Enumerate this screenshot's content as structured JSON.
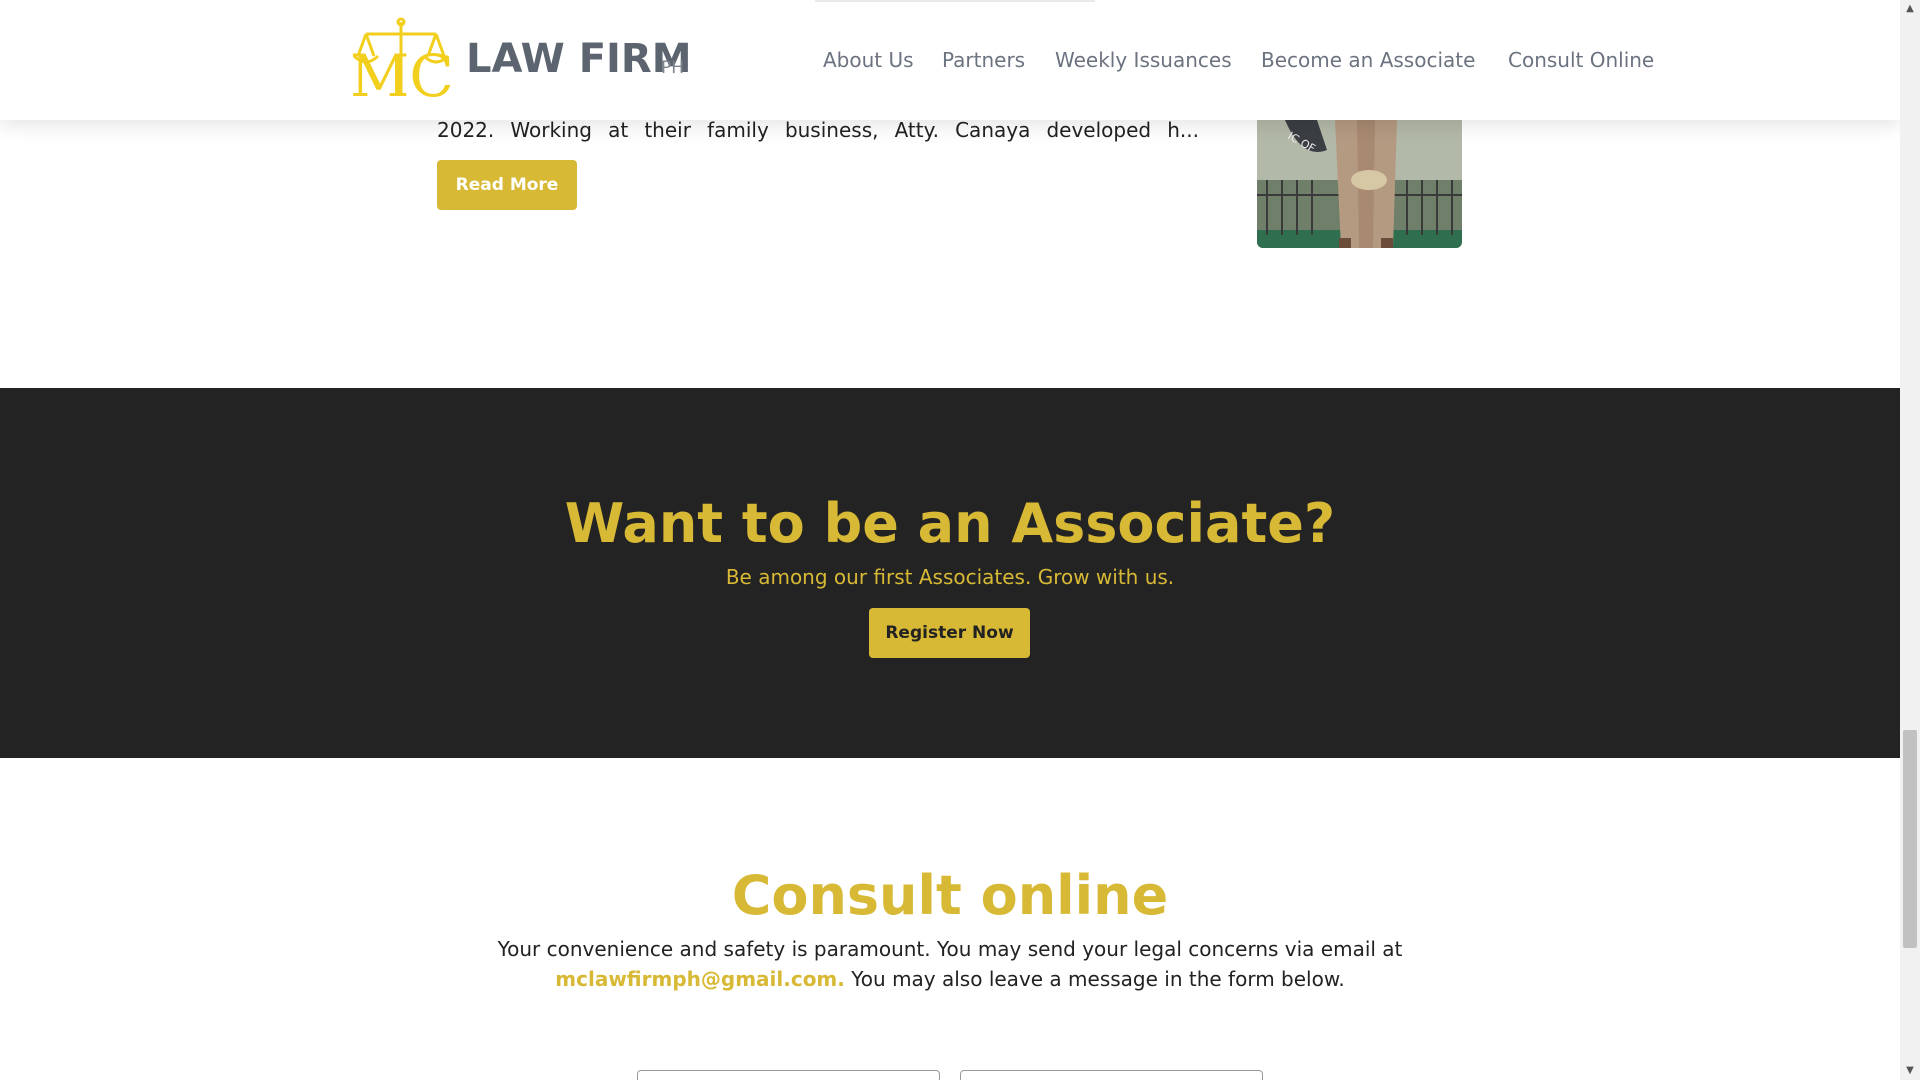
{
  "header": {
    "brand": "LAW FIRM",
    "brand_suffix": "PH",
    "logo_letters": "MC",
    "nav": [
      {
        "label": "About Us"
      },
      {
        "label": "Partners"
      },
      {
        "label": "Weekly Issuances"
      },
      {
        "label": "Become an Associate"
      },
      {
        "label": "Consult Online"
      }
    ]
  },
  "member": {
    "excerpt": "2022. Working at their family business, Atty. Canaya developed h...",
    "read_more": "Read More"
  },
  "associate": {
    "title": "Want to be an Associate?",
    "subtitle": "Be among our first Associates. Grow with us.",
    "button": "Register Now"
  },
  "consult": {
    "title": "Consult online",
    "text_1": "Your convenience and safety is paramount. You may send your legal concerns via email at",
    "email": "mclawfirmph@gmail.com.",
    "text_2": " You may also leave a message in the form below."
  },
  "colors": {
    "gold": "#d8b936",
    "dark_bg": "#232323",
    "nav_text": "#6c7380"
  },
  "scrollbar": {
    "up_icon": "triangle-up-icon",
    "down_icon": "triangle-down-icon"
  }
}
